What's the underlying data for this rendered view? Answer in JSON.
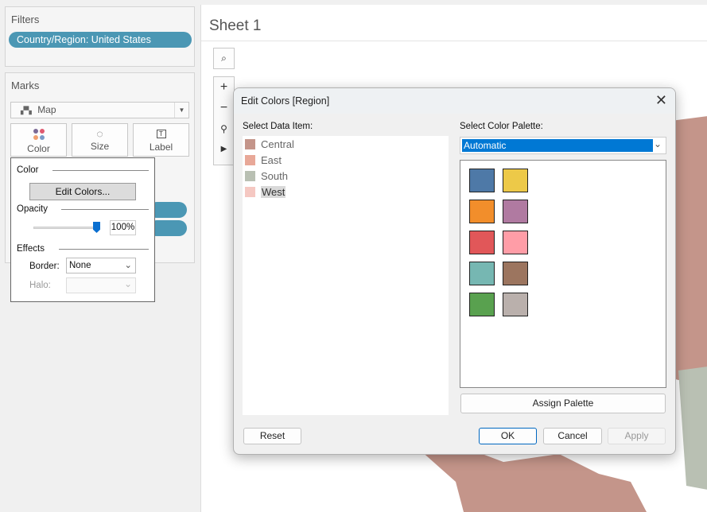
{
  "filters": {
    "title": "Filters",
    "pill": "Country/Region: United States"
  },
  "marks": {
    "title": "Marks",
    "type": "Map",
    "buttons": {
      "color": "Color",
      "size": "Size",
      "label": "Label"
    }
  },
  "color_popup": {
    "color_heading": "Color",
    "edit_colors": "Edit Colors...",
    "opacity_heading": "Opacity",
    "opacity_value": "100%",
    "opacity_percent": 100,
    "effects_heading": "Effects",
    "border_label": "Border:",
    "border_value": "None",
    "halo_label": "Halo:"
  },
  "sheet": {
    "title": "Sheet 1"
  },
  "dialog": {
    "title": "Edit Colors [Region]",
    "data_item_label": "Select Data Item:",
    "palette_label": "Select Color Palette:",
    "palette_value": "Automatic",
    "items": [
      {
        "name": "Central",
        "color": "#c4958a"
      },
      {
        "name": "East",
        "color": "#e8a898"
      },
      {
        "name": "South",
        "color": "#b9c0b3"
      },
      {
        "name": "West",
        "color": "#f5c8c2"
      }
    ],
    "selected_item": "West",
    "palette": [
      "#4e79a7",
      "#edc948",
      "#f28e2b",
      "#b07aa1",
      "#e15759",
      "#ff9da7",
      "#76b7b2",
      "#9c755f",
      "#59a14f",
      "#bab0ac"
    ],
    "assign_palette": "Assign Palette",
    "reset": "Reset",
    "ok": "OK",
    "cancel": "Cancel",
    "apply": "Apply"
  }
}
